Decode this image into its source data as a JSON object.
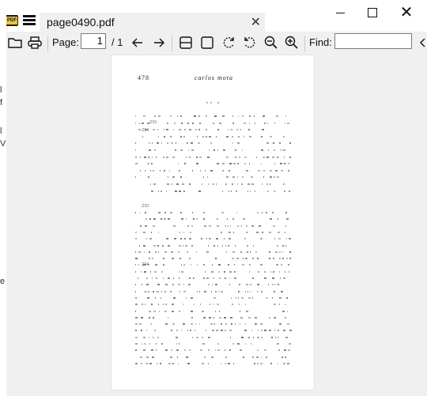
{
  "window": {
    "app_logo": "PDF",
    "tab_title": "page0490.pdf",
    "icons": {
      "menu": "menu-icon",
      "close": "close-icon",
      "minimize": "minimize-icon",
      "maximize": "maximize-icon"
    }
  },
  "toolbar": {
    "page_label": "Page:",
    "page_value": "1",
    "page_total": "/ 1",
    "find_label": "Find:",
    "find_value": "",
    "icons": [
      "open-folder-icon",
      "print-icon",
      "back-arrow-icon",
      "forward-arrow-icon",
      "fit-page-icon",
      "fit-width-icon",
      "rotate-left-icon",
      "rotate-right-icon",
      "zoom-out-icon",
      "zoom-in-icon",
      "more-icon"
    ]
  },
  "document": {
    "page_number": "478",
    "author": "carlos mota",
    "margin_numbers": [
      "233",
      "234",
      "233",
      "234"
    ]
  },
  "left_edge": {
    "chars": [
      "l",
      "f",
      "l",
      "V",
      "e"
    ]
  }
}
